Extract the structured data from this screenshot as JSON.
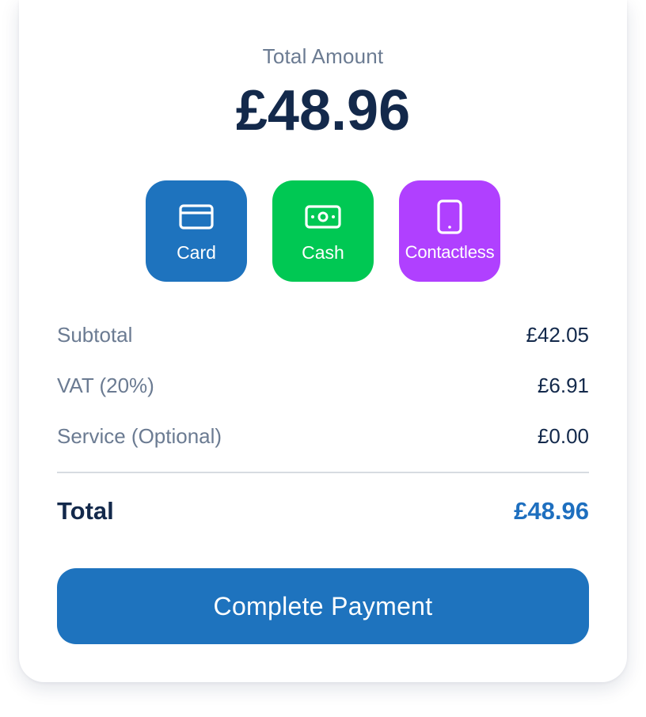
{
  "summary": {
    "total_label": "Total Amount",
    "total_amount": "£48.96"
  },
  "payment_methods": [
    {
      "label": "Card",
      "icon": "credit-card-icon",
      "color": "#1e73be"
    },
    {
      "label": "Cash",
      "icon": "banknote-icon",
      "color": "#00c853"
    },
    {
      "label": "Contactless",
      "icon": "smartphone-icon",
      "color": "#b040ff"
    }
  ],
  "breakdown": [
    {
      "label": "Subtotal",
      "value": "£42.05"
    },
    {
      "label": "VAT (20%)",
      "value": "£6.91"
    },
    {
      "label": "Service (Optional)",
      "value": "£0.00"
    }
  ],
  "total": {
    "label": "Total",
    "value": "£48.96",
    "value_color": "#1e6fbf"
  },
  "action": {
    "label": "Complete Payment",
    "color": "#1e73be"
  }
}
